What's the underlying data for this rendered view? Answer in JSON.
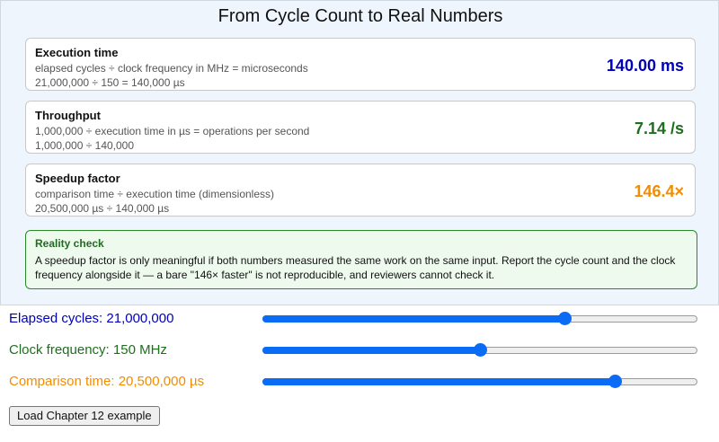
{
  "title": "From Cycle Count to Real Numbers",
  "cards": [
    {
      "name": "Execution time",
      "formula": "elapsed cycles ÷ clock frequency in MHz  =  microseconds",
      "calc": "21,000,000 ÷ 150  =  140,000 µs",
      "value": "140.00 ms",
      "color": "#0000bb"
    },
    {
      "name": "Throughput",
      "formula": "1,000,000 ÷ execution time in µs  =  operations per second",
      "calc": "1,000,000 ÷ 140,000",
      "value": "7.14 /s",
      "color": "#1f6e1f"
    },
    {
      "name": "Speedup factor",
      "formula": "comparison time ÷ execution time  (dimensionless)",
      "calc": "20,500,000 µs ÷ 140,000 µs",
      "value": "146.4×",
      "color": "#f28c00"
    }
  ],
  "reality_check": {
    "title": "Reality check",
    "body": "A speedup factor is only meaningful if both numbers measured the same work on the same input. Report the cycle count and the clock frequency alongside it — a bare \"146× faster\" is not reproducible, and reviewers cannot check it."
  },
  "controls": {
    "cycles": {
      "label": "Elapsed cycles: 21,000,000",
      "level": 0.695,
      "color": "#0000bb"
    },
    "clock": {
      "label": "Clock frequency: 150 MHz",
      "level": 0.5,
      "color": "#1f6e1f"
    },
    "comparison": {
      "label": "Comparison time: 20,500,000 µs",
      "level": 0.81,
      "color": "#f28c00"
    }
  },
  "load_button_label": "Load Chapter 12 example",
  "accent_color": "#0a6bf5"
}
